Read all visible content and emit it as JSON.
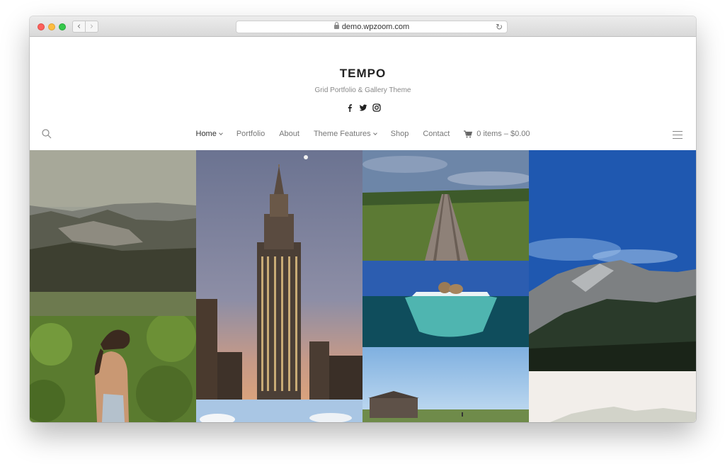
{
  "browser": {
    "url": "demo.wpzoom.com",
    "back_label": "‹",
    "forward_label": "›",
    "reload_label": "↻",
    "new_tab_label": "+"
  },
  "site": {
    "title": "TEMPO",
    "tagline": "Grid Portfolio & Gallery Theme",
    "social": [
      "facebook-icon",
      "twitter-icon",
      "instagram-icon"
    ]
  },
  "nav": {
    "items": [
      {
        "label": "Home",
        "has_dropdown": true,
        "active": true
      },
      {
        "label": "Portfolio",
        "has_dropdown": false
      },
      {
        "label": "About",
        "has_dropdown": false
      },
      {
        "label": "Theme Features",
        "has_dropdown": true
      },
      {
        "label": "Shop",
        "has_dropdown": false
      },
      {
        "label": "Contact",
        "has_dropdown": false
      }
    ],
    "cart_label": "0 items – $0.00"
  },
  "gallery": [
    {
      "subject": "forested hills"
    },
    {
      "subject": "woman in green foliage"
    },
    {
      "subject": "empire state building at dusk"
    },
    {
      "subject": "clouds and sky"
    },
    {
      "subject": "railroad tracks through forest"
    },
    {
      "subject": "walrus on ice floe"
    },
    {
      "subject": "barn in field"
    },
    {
      "subject": "mountain peaks with blue sky"
    },
    {
      "subject": "misty forest"
    }
  ],
  "colors": {
    "accent": "#222222",
    "nav_text": "#777777"
  }
}
